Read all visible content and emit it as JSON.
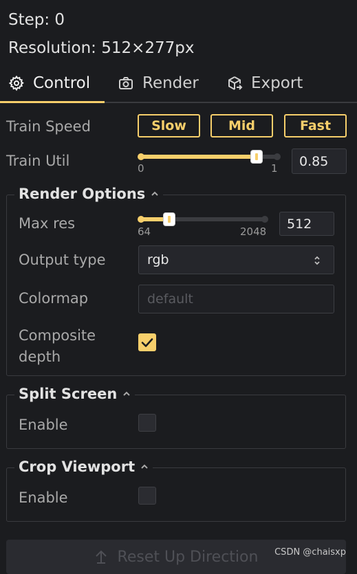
{
  "status": {
    "step": "Step: 0",
    "resolution": "Resolution: 512×277px"
  },
  "tabs": [
    {
      "label": "Control",
      "icon": "gear-icon",
      "active": true
    },
    {
      "label": "Render",
      "icon": "camera-icon",
      "active": false
    },
    {
      "label": "Export",
      "icon": "export-cube-icon",
      "active": false
    }
  ],
  "train_speed": {
    "label": "Train Speed",
    "options": [
      "Slow",
      "Mid",
      "Fast"
    ]
  },
  "train_util": {
    "label": "Train Util",
    "min": "0",
    "max": "1",
    "value": "0.85",
    "fraction": 0.85
  },
  "render_options": {
    "title": "Render Options",
    "max_res": {
      "label": "Max res",
      "min": "64",
      "max": "2048",
      "value": "512",
      "fraction": 0.23
    },
    "output_type": {
      "label": "Output type",
      "value": "rgb"
    },
    "colormap": {
      "label": "Colormap",
      "placeholder": "default"
    },
    "composite_depth": {
      "label_line1": "Composite",
      "label_line2": "depth",
      "checked": true
    }
  },
  "split_screen": {
    "title": "Split Screen",
    "enable_label": "Enable",
    "checked": false
  },
  "crop_viewport": {
    "title": "Crop Viewport",
    "enable_label": "Enable",
    "checked": false
  },
  "reset_button": {
    "label": "Reset Up Direction"
  },
  "watermark": "CSDN @chaisxp",
  "colors": {
    "accent": "#f7cf6b",
    "background": "#1b1c1f",
    "panel_border": "#3a3b3f"
  }
}
